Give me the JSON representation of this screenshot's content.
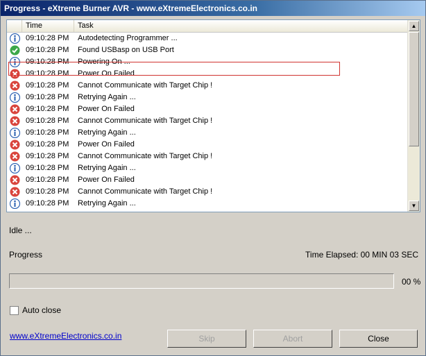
{
  "window": {
    "title": "Progress - eXtreme Burner AVR - www.eXtremeElectronics.co.in"
  },
  "log": {
    "columns": [
      "Time",
      "Task"
    ],
    "rows": [
      {
        "time": "09:10:28 PM",
        "task": "Autodetecting Programmer ...",
        "icon": "info-icon"
      },
      {
        "time": "09:10:28 PM",
        "task": "Found USBasp on USB Port",
        "icon": "success-icon"
      },
      {
        "time": "09:10:28 PM",
        "task": "Powering On ...",
        "icon": "info-icon"
      },
      {
        "time": "09:10:28 PM",
        "task": "Power On Failed",
        "icon": "error-icon"
      },
      {
        "time": "09:10:28 PM",
        "task": "Cannot Communicate with Target Chip !",
        "icon": "error-icon"
      },
      {
        "time": "09:10:28 PM",
        "task": "Retrying Again ...",
        "icon": "info-icon"
      },
      {
        "time": "09:10:28 PM",
        "task": "Power On Failed",
        "icon": "error-icon"
      },
      {
        "time": "09:10:28 PM",
        "task": "Cannot Communicate with Target Chip !",
        "icon": "error-icon"
      },
      {
        "time": "09:10:28 PM",
        "task": "Retrying Again ...",
        "icon": "info-icon"
      },
      {
        "time": "09:10:28 PM",
        "task": "Power On Failed",
        "icon": "error-icon"
      },
      {
        "time": "09:10:28 PM",
        "task": "Cannot Communicate with Target Chip !",
        "icon": "error-icon"
      },
      {
        "time": "09:10:28 PM",
        "task": "Retrying Again ...",
        "icon": "info-icon"
      },
      {
        "time": "09:10:28 PM",
        "task": "Power On Failed",
        "icon": "error-icon"
      },
      {
        "time": "09:10:28 PM",
        "task": "Cannot Communicate with Target Chip !",
        "icon": "error-icon"
      },
      {
        "time": "09:10:28 PM",
        "task": "Retrying Again ...",
        "icon": "info-icon"
      }
    ]
  },
  "status": {
    "text": "Idle ..."
  },
  "progress": {
    "label": "Progress",
    "elapsed": "Time Elapsed: 00 MIN  03 SEC",
    "percent_text": "00 %",
    "fraction": 0
  },
  "options": {
    "auto_close_label": "Auto close",
    "auto_close_checked": false
  },
  "footer": {
    "link_text": "www.eXtremeElectronics.co.in"
  },
  "buttons": {
    "skip": "Skip",
    "abort": "Abort",
    "close": "Close"
  },
  "colors": {
    "accent": "#0a246a",
    "error": "#d9443c",
    "success": "#3ca84a",
    "info": "#2a5fb0",
    "highlight_border": "#d0332f"
  }
}
